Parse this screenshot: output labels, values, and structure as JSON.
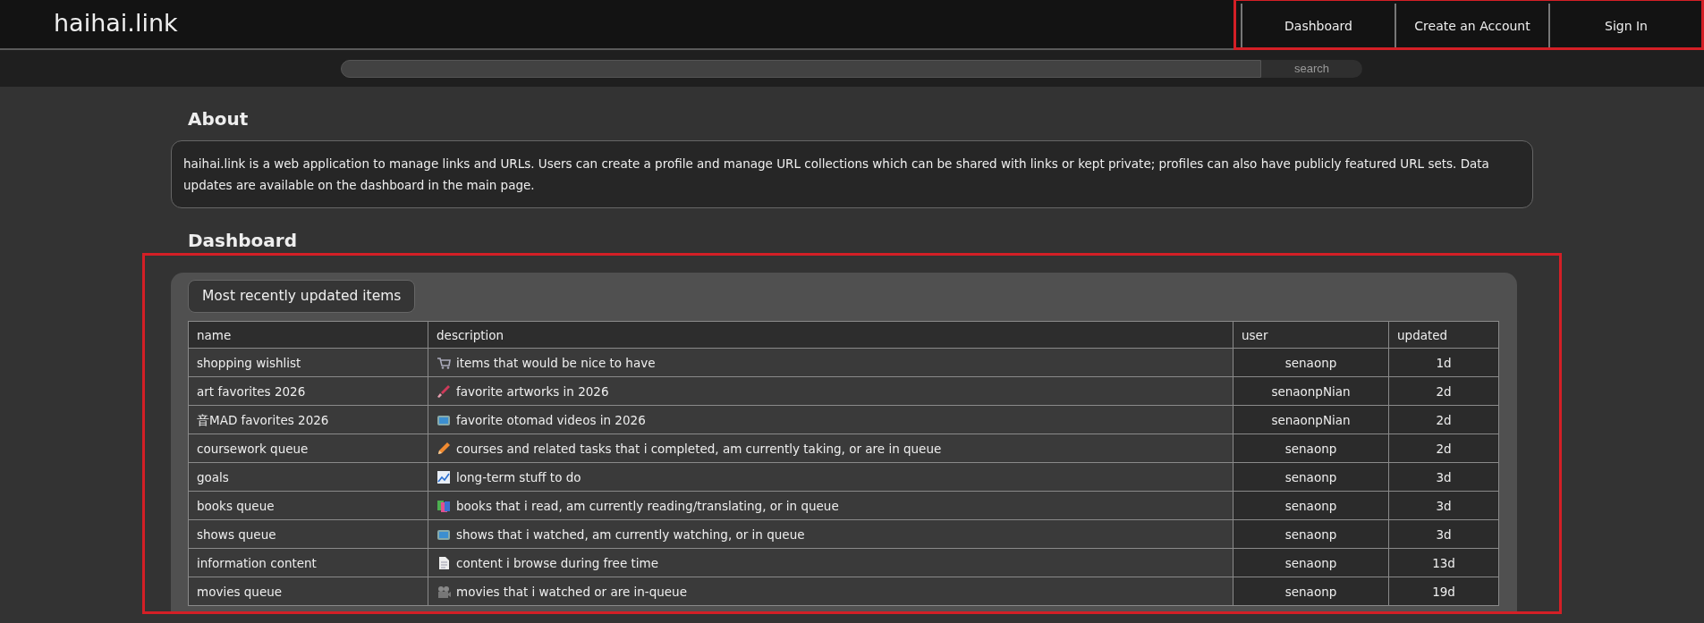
{
  "brand": "haihai.link",
  "nav": {
    "highlighted": true,
    "items": [
      "Dashboard",
      "Create an Account",
      "Sign In"
    ]
  },
  "search": {
    "button": "search"
  },
  "about": {
    "heading": "About",
    "text": "haihai.link is a web application to manage links and URLs. Users can create a profile and manage URL collections which can be shared with links or kept private; profiles can also have publicly featured URL sets. Data updates are available on the dashboard in the main page."
  },
  "dashboard": {
    "heading": "Dashboard",
    "highlighted": true,
    "caption": "Most recently updated items",
    "table": {
      "columns": [
        "name",
        "description",
        "user",
        "updated"
      ],
      "rows": [
        {
          "name": "shopping wishlist",
          "kind": "cart",
          "description": "items that would be nice to have",
          "user": "senaonp",
          "updated": "1d"
        },
        {
          "name": "art favorites 2026",
          "kind": "brush",
          "description": "favorite artworks in 2026",
          "user": "senaonpNian",
          "updated": "2d"
        },
        {
          "name": "音MAD favorites 2026",
          "kind": "tv",
          "description": "favorite otomad videos in 2026",
          "user": "senaonpNian",
          "updated": "2d"
        },
        {
          "name": "coursework queue",
          "kind": "pencil",
          "description": "courses and related tasks that i completed, am currently taking, or are in queue",
          "user": "senaonp",
          "updated": "2d"
        },
        {
          "name": "goals",
          "kind": "chart",
          "description": "long-term stuff to do",
          "user": "senaonp",
          "updated": "3d"
        },
        {
          "name": "books queue",
          "kind": "books",
          "description": "books that i read, am currently reading/translating, or in queue",
          "user": "senaonp",
          "updated": "3d"
        },
        {
          "name": "shows queue",
          "kind": "tv",
          "description": "shows that i watched, am currently watching, or in queue",
          "user": "senaonp",
          "updated": "3d"
        },
        {
          "name": "information content",
          "kind": "document",
          "description": "content i browse during free time",
          "user": "senaonp",
          "updated": "13d"
        },
        {
          "name": "movies queue",
          "kind": "camera",
          "description": "movies that i watched or are in-queue",
          "user": "senaonp",
          "updated": "19d"
        }
      ]
    }
  }
}
